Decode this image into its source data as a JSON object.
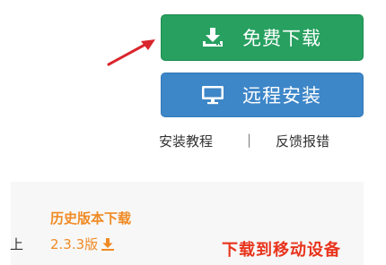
{
  "download": {
    "free_label": "免费下载",
    "remote_label": "远程安装",
    "free_icon": "download-tray-icon",
    "remote_icon": "monitor-icon",
    "colors": {
      "green": "#27a060",
      "blue": "#3d86c8"
    }
  },
  "links": {
    "tutorial": "安装教程",
    "separator": "|",
    "report": "反馈报错"
  },
  "history": {
    "title": "历史版本下载",
    "version": "2.3.3版",
    "version_icon": "download-icon",
    "left_fragment": "上"
  },
  "annotation": {
    "text": "下载到移动设备",
    "arrow_color": "#d9262c",
    "text_color": "#e8341c"
  }
}
